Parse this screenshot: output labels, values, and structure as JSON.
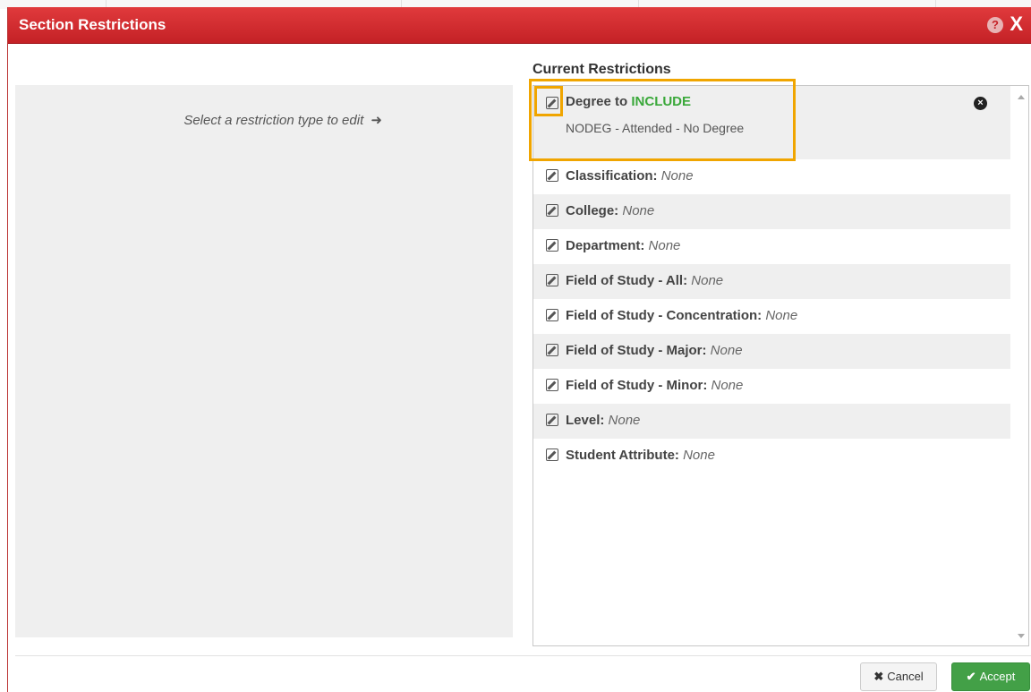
{
  "dialog": {
    "title": "Section Restrictions",
    "help_icon": "?",
    "close_icon": "X"
  },
  "left_panel": {
    "hint": "Select a restriction type to edit",
    "arrow_icon": "➜"
  },
  "current_restrictions": {
    "heading": "Current Restrictions",
    "active": {
      "label": "Degree to ",
      "mode": "INCLUDE",
      "value": "NODEG - Attended - No Degree",
      "remove_icon": "×"
    },
    "items": [
      {
        "label": "Classification:",
        "value": "None"
      },
      {
        "label": "College:",
        "value": "None"
      },
      {
        "label": "Department:",
        "value": "None"
      },
      {
        "label": "Field of Study - All:",
        "value": "None"
      },
      {
        "label": "Field of Study - Concentration:",
        "value": "None"
      },
      {
        "label": "Field of Study - Major:",
        "value": "None"
      },
      {
        "label": "Field of Study - Minor:",
        "value": "None"
      },
      {
        "label": "Level:",
        "value": "None"
      },
      {
        "label": "Student Attribute:",
        "value": "None"
      }
    ]
  },
  "footer": {
    "cancel_label": "Cancel",
    "cancel_icon": "✖",
    "accept_label": "Accept",
    "accept_icon": "✔"
  },
  "colors": {
    "titlebar": "#c42126",
    "include_accent": "#3aa83a",
    "highlight": "#f0a500",
    "accept_button": "#43a047"
  }
}
